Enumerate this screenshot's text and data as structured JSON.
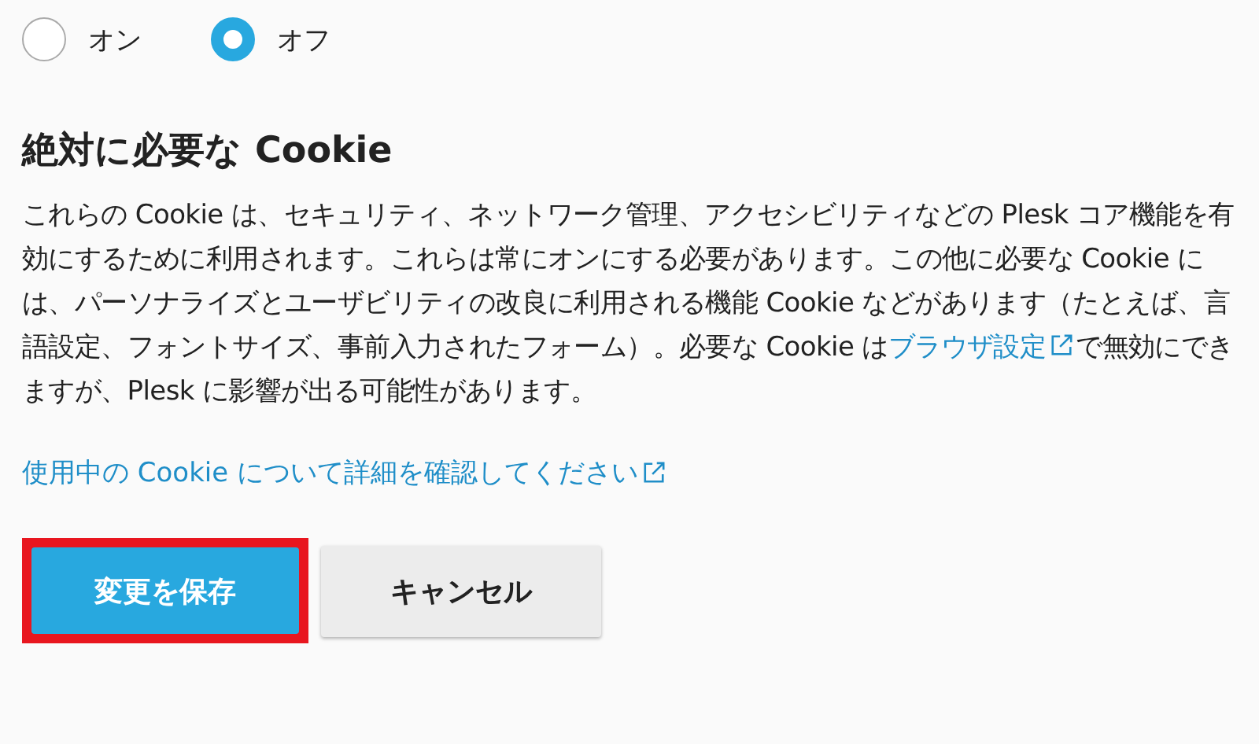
{
  "radios": [
    {
      "label": "オン",
      "selected": false
    },
    {
      "label": "オフ",
      "selected": true
    }
  ],
  "section": {
    "title": "絶対に必要な Cookie",
    "description": {
      "before": "これらの Cookie は、セキュリティ、ネットワーク管理、アクセシビリティなどの Plesk コア機能を有効にするために利用されます。これらは常にオンにする必要があります。この他に必要な Cookie には、パーソナライズとユーザビリティの改良に利用される機能 Cookie などがあります（たとえば、言語設定、フォントサイズ、事前入力されたフォーム）。必要な Cookie は",
      "link": "ブラウザ設定",
      "after": "で無効にできますが、Plesk に影響が出る可能性があります。"
    }
  },
  "details_link": "使用中の Cookie について詳細を確認してください",
  "buttons": [
    {
      "label": "変更を保存",
      "kind": "primary",
      "highlighted": true
    },
    {
      "label": "キャンセル",
      "kind": "secondary",
      "highlighted": false
    }
  ]
}
